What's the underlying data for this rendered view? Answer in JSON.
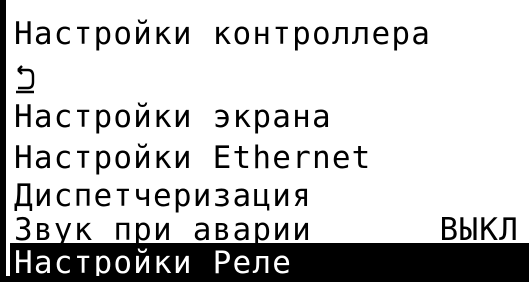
{
  "screen": {
    "title": "Настройки контроллера",
    "back_icon": "return-arrow-icon",
    "menu": [
      {
        "label": "Настройки экрана"
      },
      {
        "label": "Настройки Ethernet"
      },
      {
        "label": "Диспетчеризация"
      },
      {
        "label": "Звук при аварии",
        "value": "ВЫКЛ"
      },
      {
        "label": "Настройки Реле",
        "selected": true
      }
    ]
  }
}
